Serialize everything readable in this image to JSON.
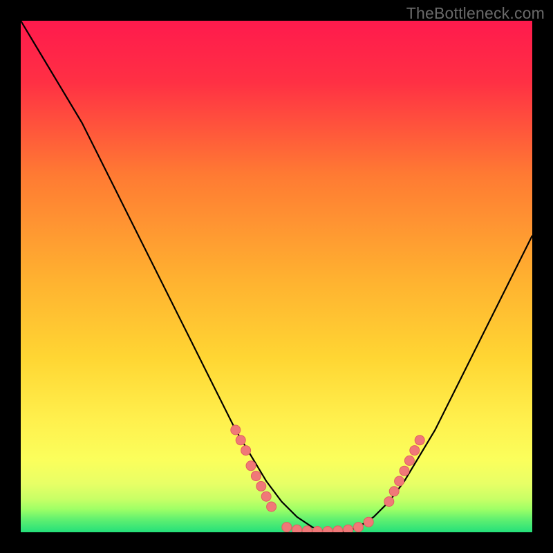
{
  "watermark": "TheBottleneck.com",
  "colors": {
    "background": "#000000",
    "top": "#ff1a4d",
    "mid_upper": "#ff7a33",
    "mid": "#ffd633",
    "mid_lower": "#fff766",
    "low1": "#e8ff66",
    "low2": "#9eff66",
    "bottom": "#24e07a",
    "curve": "#000000",
    "marker_fill": "#f07878",
    "marker_stroke": "#e06060"
  },
  "chart_data": {
    "type": "line",
    "title": "",
    "xlabel": "",
    "ylabel": "",
    "xlim": [
      0,
      100
    ],
    "ylim": [
      0,
      100
    ],
    "x": [
      0,
      3,
      6,
      9,
      12,
      15,
      18,
      21,
      24,
      27,
      30,
      33,
      36,
      39,
      42,
      45,
      48,
      51,
      54,
      57,
      60,
      63,
      66,
      69,
      72,
      75,
      78,
      81,
      84,
      87,
      90,
      93,
      96,
      99,
      100
    ],
    "values": [
      100,
      95,
      90,
      85,
      80,
      74,
      68,
      62,
      56,
      50,
      44,
      38,
      32,
      26,
      20,
      15,
      10,
      6,
      3,
      1,
      0,
      0,
      1,
      3,
      6,
      10,
      15,
      20,
      26,
      32,
      38,
      44,
      50,
      56,
      58
    ],
    "series": [
      {
        "name": "bottleneck-curve",
        "type": "line",
        "x_ref": "x",
        "values_ref": "values"
      },
      {
        "name": "marker-cluster-left",
        "type": "scatter",
        "points": [
          {
            "x": 42,
            "y": 20
          },
          {
            "x": 43,
            "y": 18
          },
          {
            "x": 44,
            "y": 16
          },
          {
            "x": 45,
            "y": 13
          },
          {
            "x": 46,
            "y": 11
          },
          {
            "x": 47,
            "y": 9
          },
          {
            "x": 48,
            "y": 7
          },
          {
            "x": 49,
            "y": 5
          }
        ]
      },
      {
        "name": "marker-cluster-bottom",
        "type": "scatter",
        "points": [
          {
            "x": 52,
            "y": 1
          },
          {
            "x": 54,
            "y": 0.5
          },
          {
            "x": 56,
            "y": 0.3
          },
          {
            "x": 58,
            "y": 0.2
          },
          {
            "x": 60,
            "y": 0.2
          },
          {
            "x": 62,
            "y": 0.3
          },
          {
            "x": 64,
            "y": 0.5
          },
          {
            "x": 66,
            "y": 1
          },
          {
            "x": 68,
            "y": 2
          }
        ]
      },
      {
        "name": "marker-cluster-right",
        "type": "scatter",
        "points": [
          {
            "x": 72,
            "y": 6
          },
          {
            "x": 73,
            "y": 8
          },
          {
            "x": 74,
            "y": 10
          },
          {
            "x": 75,
            "y": 12
          },
          {
            "x": 76,
            "y": 14
          },
          {
            "x": 77,
            "y": 16
          },
          {
            "x": 78,
            "y": 18
          }
        ]
      }
    ]
  }
}
